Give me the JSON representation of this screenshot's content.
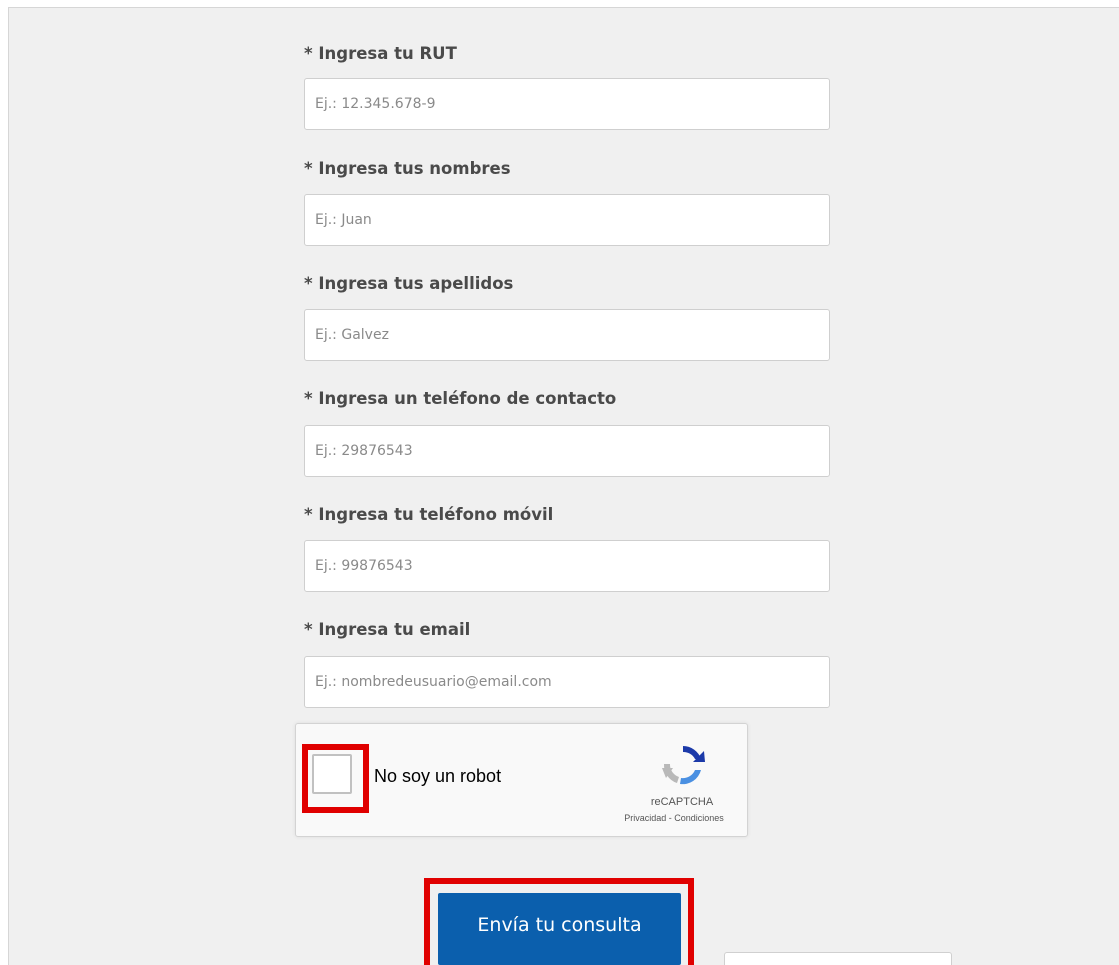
{
  "form": {
    "fields": [
      {
        "label": "* Ingresa tu RUT",
        "placeholder": "Ej.: 12.345.678-9",
        "value": ""
      },
      {
        "label": "* Ingresa tus nombres",
        "placeholder": "Ej.: Juan",
        "value": ""
      },
      {
        "label": "* Ingresa tus apellidos",
        "placeholder": "Ej.: Galvez",
        "value": ""
      },
      {
        "label": "* Ingresa un teléfono de contacto",
        "placeholder": "Ej.: 29876543",
        "value": ""
      },
      {
        "label": "* Ingresa tu teléfono móvil",
        "placeholder": "Ej.: 99876543",
        "value": ""
      },
      {
        "label": "* Ingresa tu email",
        "placeholder": "Ej.: nombredeusuario@email.com",
        "value": ""
      }
    ],
    "submit_label": "Envía tu consulta"
  },
  "captcha": {
    "checkbox_label": "No soy un robot",
    "checked": false,
    "brand": "reCAPTCHA",
    "links": "Privacidad - Condiciones",
    "icon": "recaptcha-icon"
  },
  "colors": {
    "submit_button": "#0b5fad",
    "highlight": "#e00000",
    "panel_background": "#f0f0f0"
  }
}
